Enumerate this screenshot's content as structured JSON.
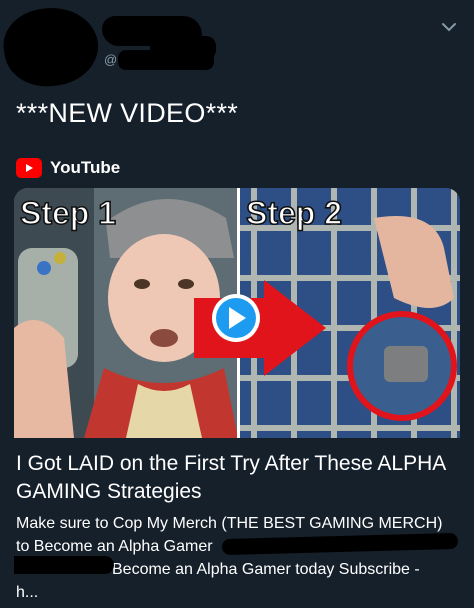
{
  "header": {
    "handle_fragment": "@..."
  },
  "tweet": {
    "text": "***NEW VIDEO***"
  },
  "card": {
    "source": "YouTube",
    "thumbnail": {
      "left_caption": "Step 1",
      "right_caption": "Step 2"
    },
    "title": "I Got LAID on the First Try After These ALPHA GAMING Strategies",
    "description_line1": "Make sure to Cop My Merch (THE BEST GAMING MERCH)",
    "description_line2": "to Become an Alpha Gamer",
    "description_line3": "Become an Alpha Gamer today Subscribe -",
    "description_line4": "h..."
  },
  "colors": {
    "background": "#15202b",
    "youtube_red": "#ff0000",
    "muted": "#8899a6"
  }
}
